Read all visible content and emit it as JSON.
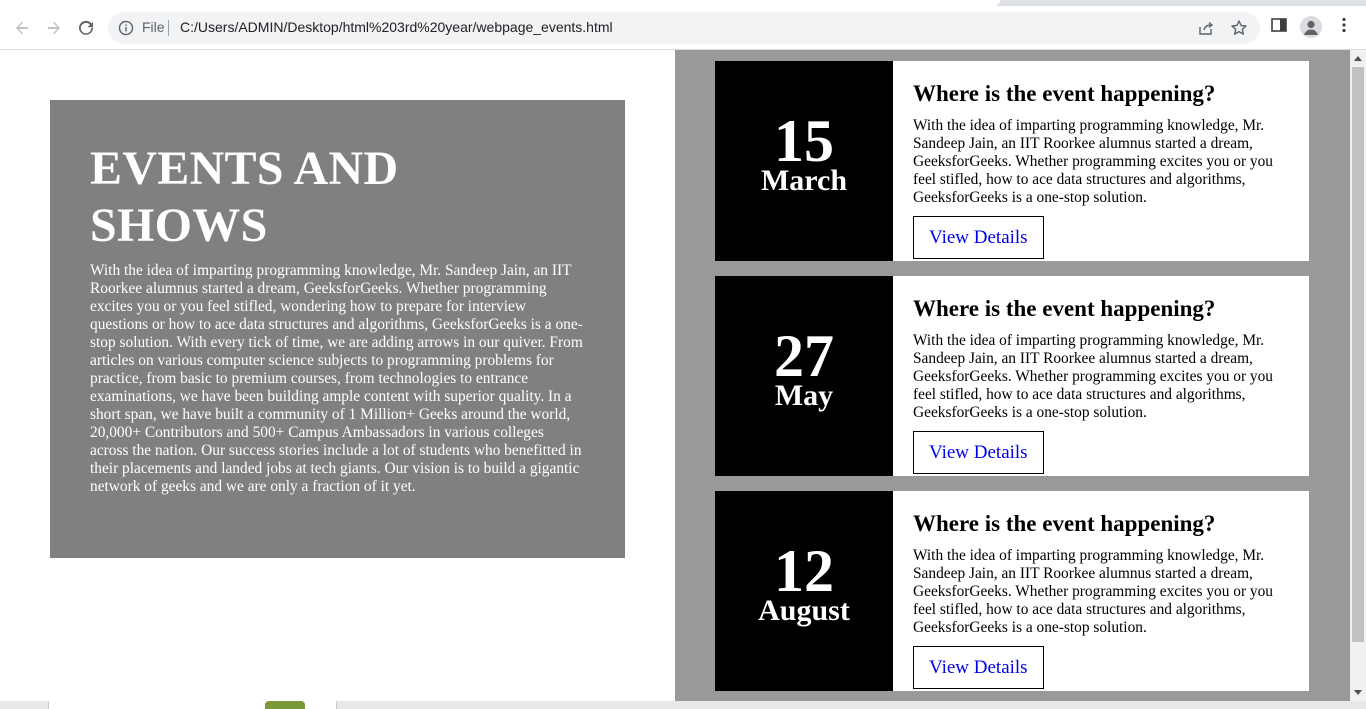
{
  "browser": {
    "url_scheme_label": "File",
    "url": "C:/Users/ADMIN/Desktop/html%203rd%20year/webpage_events.html",
    "icons": [
      "back-arrow-icon",
      "forward-arrow-icon",
      "reload-icon",
      "info-icon",
      "share-icon",
      "star-icon",
      "side-panel-icon",
      "profile-icon",
      "more-vert-icon"
    ]
  },
  "intro": {
    "title": "EVENTS AND SHOWS",
    "body": "With the idea of imparting programming knowledge, Mr. Sandeep Jain, an IIT Roorkee alumnus started a dream, GeeksforGeeks. Whether programming excites you or you feel stifled, wondering how to prepare for interview questions or how to ace data structures and algorithms, GeeksforGeeks is a one-stop solution. With every tick of time, we are adding arrows in our quiver. From articles on various computer science subjects to programming problems for practice, from basic to premium courses, from technologies to entrance examinations, we have been building ample content with superior quality. In a short span, we have built a community of 1 Million+ Geeks around the world, 20,000+ Contributors and 500+ Campus Ambassadors in various colleges across the nation. Our success stories include a lot of students who benefitted in their placements and landed jobs at tech giants. Our vision is to build a gigantic network of geeks and we are only a fraction of it yet."
  },
  "events": [
    {
      "day": "15",
      "month": "March",
      "heading": "Where is the event happening?",
      "description": "With the idea of imparting programming knowledge, Mr. Sandeep Jain, an IIT Roorkee alumnus started a dream, GeeksforGeeks. Whether programming excites you or you feel stifled, how to ace data structures and algorithms, GeeksforGeeks is a one-stop solution.",
      "button": "View Details"
    },
    {
      "day": "27",
      "month": "May",
      "heading": "Where is the event happening?",
      "description": "With the idea of imparting programming knowledge, Mr. Sandeep Jain, an IIT Roorkee alumnus started a dream, GeeksforGeeks. Whether programming excites you or you feel stifled, how to ace data structures and algorithms, GeeksforGeeks is a one-stop solution.",
      "button": "View Details"
    },
    {
      "day": "12",
      "month": "August",
      "heading": "Where is the event happening?",
      "description": "With the idea of imparting programming knowledge, Mr. Sandeep Jain, an IIT Roorkee alumnus started a dream, GeeksforGeeks. Whether programming excites you or you feel stifled, how to ace data structures and algorithms, GeeksforGeeks is a one-stop solution.",
      "button": "View Details"
    }
  ],
  "colors": {
    "intro_bg": "#808080",
    "events_bg": "#999999",
    "date_bg": "#000000",
    "link": "#0000ee"
  }
}
